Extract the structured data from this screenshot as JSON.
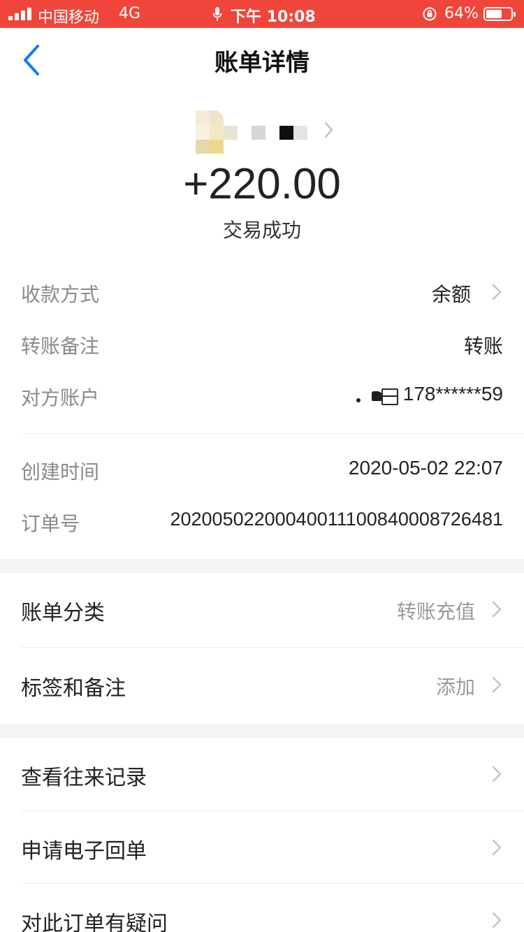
{
  "status_bar": {
    "carrier": "中国移动",
    "network": "4G",
    "time": "下午 10:08",
    "battery": "64%",
    "battery_level": 0.64
  },
  "nav": {
    "title": "账单详情",
    "back_icon": "chevron-left-icon"
  },
  "summary": {
    "amount": "+220.00",
    "status": "交易成功"
  },
  "details": [
    {
      "label": "收款方式",
      "value": "余额",
      "has_chevron": true
    },
    {
      "label": "转账备注",
      "value": "转账",
      "has_chevron": false
    },
    {
      "label": "对方账户",
      "value": "178******59",
      "has_chevron": false
    },
    {
      "label": "创建时间",
      "value": "2020-05-02 22:07",
      "has_chevron": false
    },
    {
      "label": "订单号",
      "value": "20200502200040011100840008726481",
      "has_chevron": false
    }
  ],
  "category_section": [
    {
      "label": "账单分类",
      "value": "转账充值"
    },
    {
      "label": "标签和备注",
      "value": "添加"
    }
  ],
  "action_section": [
    {
      "label": "查看往来记录"
    },
    {
      "label": "申请电子回单"
    },
    {
      "label": "对此订单有疑问"
    }
  ],
  "colors": {
    "status_bar": "#f0453a",
    "accent": "#1677ff",
    "label_gray": "#8a8a8a",
    "divider": "#ececec",
    "section_gap": "#f4f4f4"
  }
}
